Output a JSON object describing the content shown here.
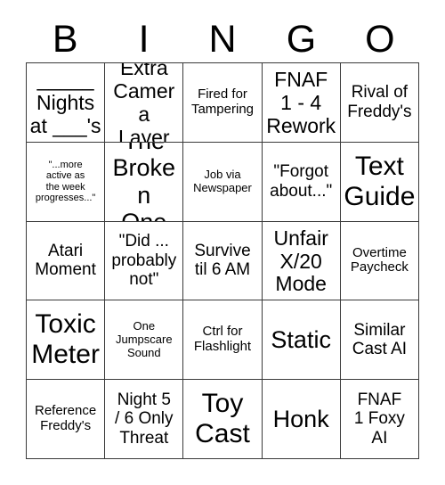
{
  "card": {
    "title": "BINGO",
    "header_letters": [
      "B",
      "I",
      "N",
      "G",
      "O"
    ],
    "grid_size": "5x5",
    "colors": {
      "background": "#ffffff",
      "text": "#000000",
      "border": "#3a3a3a"
    },
    "cells": [
      {
        "text": "_____\nNights\nat ___'s",
        "size": "lg"
      },
      {
        "text": "Extra\nCamera\nLayer",
        "size": "lg"
      },
      {
        "text": "Fired for\nTampering",
        "size": "sm"
      },
      {
        "text": "FNAF\n1 - 4\nRework",
        "size": "lg"
      },
      {
        "text": "Rival of\nFreddy's",
        "size": "md"
      },
      {
        "text": "\"...more\nactive as\nthe week\nprogresses...\"",
        "size": "xxs"
      },
      {
        "text": "The\nBroken\nOne",
        "size": "xl"
      },
      {
        "text": "Job via\nNewspaper",
        "size": "xs"
      },
      {
        "text": "\"Forgot\nabout...\"",
        "size": "md"
      },
      {
        "text": "Text\nGuide",
        "size": "xxl"
      },
      {
        "text": "Atari\nMoment",
        "size": "md"
      },
      {
        "text": "\"Did ...\nprobably\nnot\"",
        "size": "md"
      },
      {
        "text": "Survive\ntil 6 AM",
        "size": "md"
      },
      {
        "text": "Unfair\nX/20\nMode",
        "size": "lg"
      },
      {
        "text": "Overtime\nPaycheck",
        "size": "sm"
      },
      {
        "text": "Toxic\nMeter",
        "size": "xxl"
      },
      {
        "text": "One\nJumpscare\nSound",
        "size": "xs"
      },
      {
        "text": "Ctrl for\nFlashlight",
        "size": "sm"
      },
      {
        "text": "Static",
        "size": "xl"
      },
      {
        "text": "Similar\nCast AI",
        "size": "md"
      },
      {
        "text": "Reference\nFreddy's",
        "size": "sm"
      },
      {
        "text": "Night 5\n/ 6 Only\nThreat",
        "size": "md"
      },
      {
        "text": "Toy\nCast",
        "size": "xxl"
      },
      {
        "text": "Honk",
        "size": "xl"
      },
      {
        "text": "FNAF\n1 Foxy\nAI",
        "size": "md"
      }
    ]
  }
}
